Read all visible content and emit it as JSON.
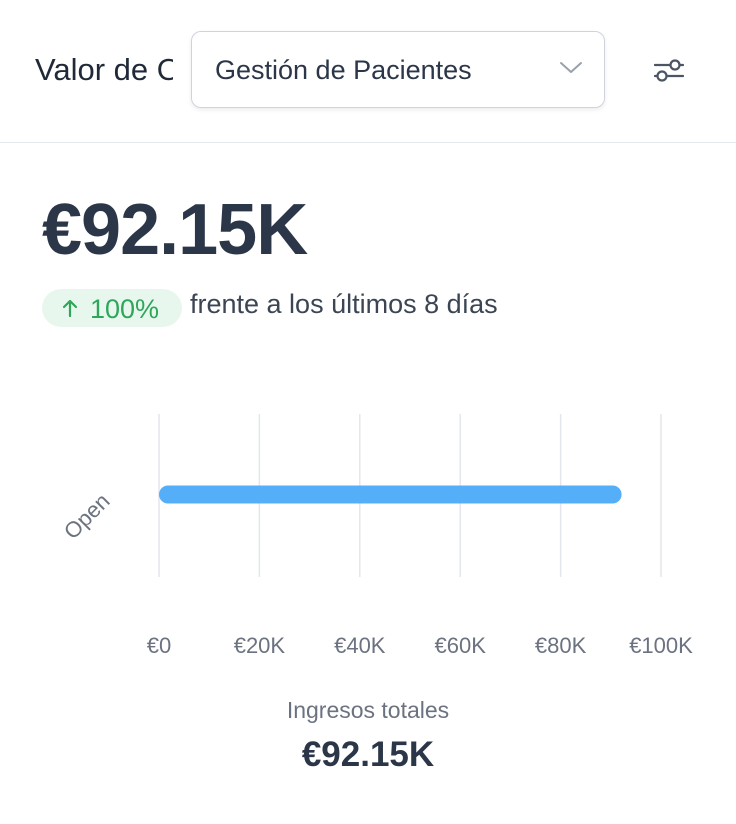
{
  "header": {
    "title": "Valor de Oportunidades",
    "dropdown": {
      "selected": "Gestión de Pacientes"
    },
    "filter_icon": "filter-sliders-icon"
  },
  "metric": {
    "value": "€92.15K",
    "change_badge": "100%",
    "change_arrow_icon": "arrow-up-icon",
    "comparison_text": "frente a los últimos 8 días"
  },
  "colors": {
    "bar": "#55aff8",
    "badge_bg": "#e8f7ee",
    "badge_text": "#2fa65a",
    "text_primary": "#2b3648"
  },
  "chart_data": {
    "type": "bar",
    "orientation": "horizontal",
    "categories": [
      "Open"
    ],
    "values": [
      92150
    ],
    "xlim": [
      0,
      100000
    ],
    "x_ticks": [
      0,
      20000,
      40000,
      60000,
      80000,
      100000
    ],
    "x_tick_labels": [
      "€0",
      "€20K",
      "€40K",
      "€60K",
      "€80K",
      "€100K"
    ],
    "grid": "vertical",
    "legend": "none",
    "xlabel": "",
    "ylabel": ""
  },
  "footer": {
    "label": "Ingresos totales",
    "value": "€92.15K"
  }
}
